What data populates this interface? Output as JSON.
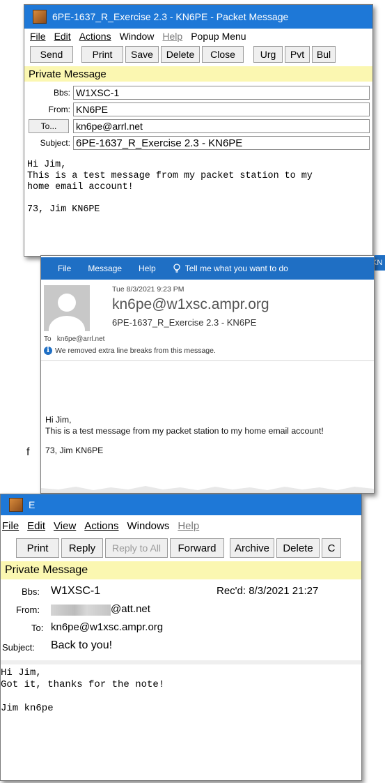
{
  "win1": {
    "title": "6PE-1637_R_Exercise 2.3 - KN6PE - Packet Message",
    "menu": {
      "file": "File",
      "edit": "Edit",
      "actions": "Actions",
      "window": "Window",
      "help": "Help",
      "popup": "Popup Menu"
    },
    "toolbar": {
      "send": "Send",
      "print": "Print",
      "save": "Save",
      "delete": "Delete",
      "close": "Close",
      "urg": "Urg",
      "pvt": "Pvt",
      "bul": "Bul"
    },
    "banner": "Private Message",
    "labels": {
      "bbs": "Bbs:",
      "from": "From:",
      "to": "To...",
      "subject": "Subject:"
    },
    "values": {
      "bbs": "W1XSC-1",
      "from": "KN6PE",
      "to": "kn6pe@arrl.net",
      "subject": "6PE-1637_R_Exercise 2.3 - KN6PE"
    },
    "body": "Hi Jim,\nThis is a test message from my packet station to my\nhome email account!\n\n73, Jim KN6PE",
    "edge_fragment": "KN"
  },
  "win2": {
    "menu": {
      "file": "File",
      "message": "Message",
      "help": "Help",
      "tell": "Tell me what you want to do"
    },
    "date": "Tue 8/3/2021 9:23 PM",
    "sender": "kn6pe@w1xsc.ampr.org",
    "subject": "6PE-1637_R_Exercise 2.3 - KN6PE",
    "to_label": "To",
    "to_value": "kn6pe@arrl.net",
    "notice": "We removed extra line breaks from this message.",
    "body_line1": "Hi Jim,",
    "body_line2": "This is a test message from my packet station to my home email account!",
    "body_line3": "73, Jim KN6PE"
  },
  "stray": "f",
  "win3": {
    "title_fragment": "E",
    "menu": {
      "file": "File",
      "edit": "Edit",
      "view": "View",
      "actions": "Actions",
      "windows": "Windows",
      "help": "Help"
    },
    "toolbar": {
      "print": "Print",
      "reply": "Reply",
      "reply_all": "Reply to All",
      "forward": "Forward",
      "archive": "Archive",
      "delete": "Delete",
      "more": "C"
    },
    "banner": "Private Message",
    "labels": {
      "bbs": "Bbs:",
      "from": "From:",
      "to": "To:",
      "subject": "Subject:"
    },
    "values": {
      "bbs": "W1XSC-1",
      "from": "@att.net",
      "to": "kn6pe@w1xsc.ampr.org",
      "subject": "Back to you!"
    },
    "recd": "Rec'd:  8/3/2021 21:27",
    "body": "Hi Jim,\nGot it, thanks for the note!\n\nJim kn6pe"
  },
  "colors": {
    "titlebar": "#1e78d7",
    "ribbon": "#1f6fc4",
    "banner": "#fbf7b1"
  }
}
